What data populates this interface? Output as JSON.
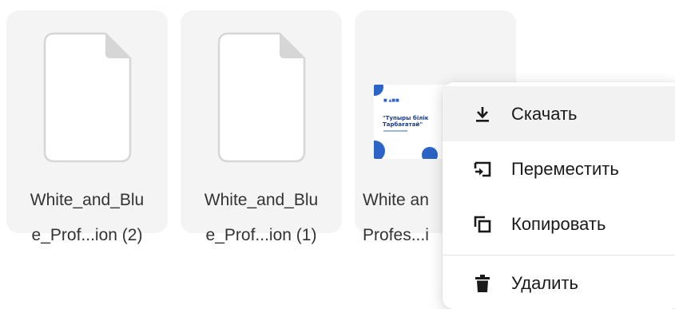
{
  "files": [
    {
      "name_line1": "White_and_Blu",
      "name_line2": "e_Prof...ion (2)",
      "type_icon": "document-icon"
    },
    {
      "name_line1": "White_and_Blu",
      "name_line2": "e_Prof...ion (1)",
      "type_icon": "document-icon"
    },
    {
      "name_line1": "White an",
      "name_line2": "Profes...i",
      "thumbnail_title_line1": "\"Тупыры білік",
      "thumbnail_title_line2": "Тарбағатай\""
    }
  ],
  "context_menu": {
    "items": [
      {
        "label": "Скачать",
        "icon": "download-icon"
      },
      {
        "label": "Переместить",
        "icon": "move-icon"
      },
      {
        "label": "Копировать",
        "icon": "copy-icon"
      },
      {
        "label": "Удалить",
        "icon": "trash-icon"
      }
    ]
  },
  "colors": {
    "tile_bg": "#f4f4f4",
    "menu_hover_bg": "#f2f2f2",
    "text": "#333333",
    "thumbnail_accent": "#2b63c6"
  }
}
